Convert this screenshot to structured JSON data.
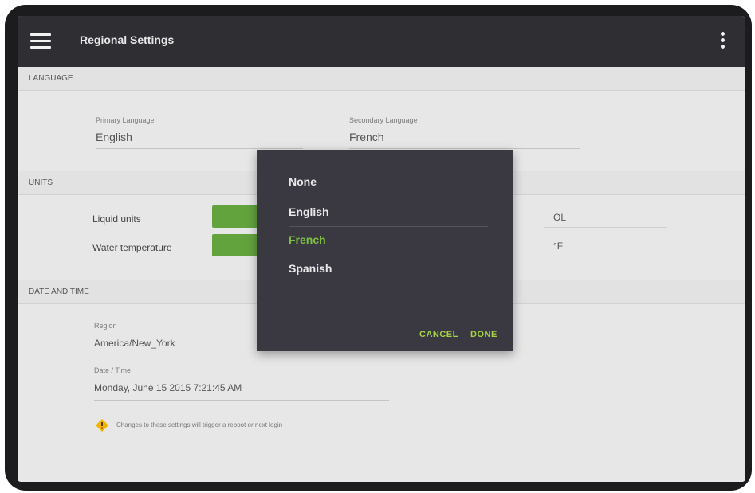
{
  "appbar": {
    "title": "Regional Settings",
    "menu_icon": "hamburger-menu-icon",
    "overflow_icon": "more-vertical-icon"
  },
  "sections": {
    "language": {
      "header": "LANGUAGE",
      "primary_label": "Primary Language",
      "primary_value": "English",
      "secondary_label": "Secondary Language",
      "secondary_value": "French"
    },
    "units": {
      "header": "UNITS",
      "rows": [
        {
          "label": "Liquid units",
          "value": "OL"
        },
        {
          "label": "Water temperature",
          "value": "°F"
        }
      ]
    },
    "date_and_time": {
      "header": "DATE AND TIME",
      "region_label": "Region",
      "region_value": "America/New_York",
      "datetime_label": "Date / Time",
      "datetime_value": "Monday, June 15 2015 7:21:45 AM"
    },
    "warning": {
      "icon": "warning-diamond-icon",
      "text": "Changes to these settings will trigger a reboot or next login"
    }
  },
  "dialog": {
    "options": [
      "None",
      "English",
      "French",
      "Spanish"
    ],
    "selected": "French",
    "cancel_label": "CANCEL",
    "done_label": "DONE"
  },
  "colors": {
    "appbar": "#2e2e33",
    "accent_green": "#63a33e",
    "dialog_bg": "#3a3942",
    "dialog_selected": "#7bc043",
    "dialog_button": "#a7d443",
    "warning": "#f2b400"
  }
}
